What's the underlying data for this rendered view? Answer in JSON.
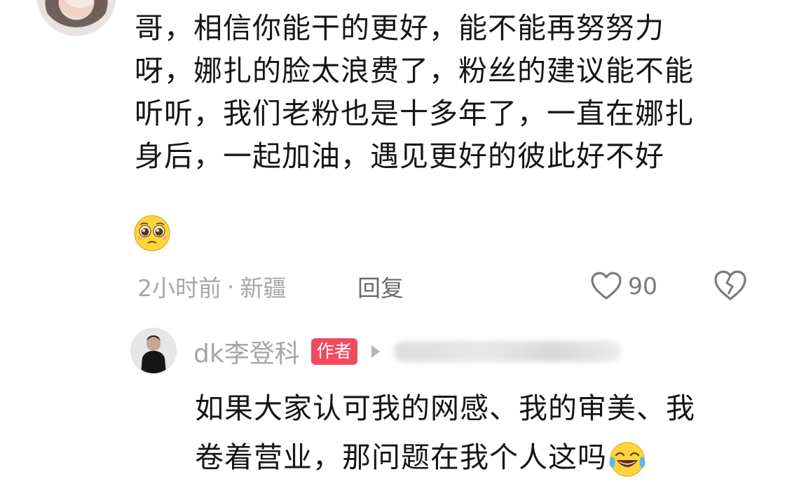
{
  "comment": {
    "lines": [
      "哥，相信你能干的更好，能不能再努努力",
      "呀，娜扎的脸太浪费了，粉丝的建议能不能",
      "听听，我们老粉也是十多年了，一直在娜扎",
      "身后，一起加油，遇见更好的彼此好不好"
    ],
    "emoji": "pleading-face-icon",
    "time": "2小时前",
    "separator": "·",
    "location": "新疆",
    "reply_label": "回复",
    "like_count": "90"
  },
  "reply": {
    "author_name": "dk李登科",
    "author_badge": "作者",
    "lines": [
      "如果大家认可我的网感、我的审美、我",
      "卷着营业，那问题在我个人这吗"
    ],
    "emoji": "laughing-tears-face-icon"
  },
  "colors": {
    "text": "#161616",
    "meta": "#a7a7a7",
    "badge": "#f14a5e"
  }
}
